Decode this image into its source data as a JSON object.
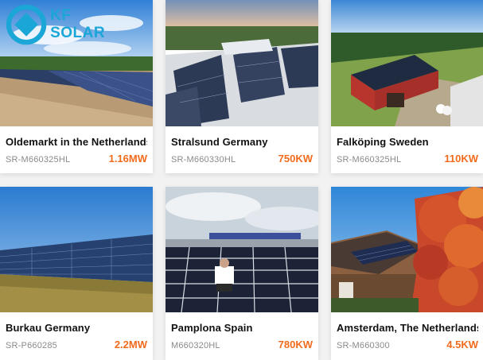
{
  "brand": {
    "logo_text": "KF SOLAR"
  },
  "colors": {
    "accent": "#f26b1d",
    "model_text": "#8a8a8a",
    "logo": "#1aa6d6"
  },
  "projects": [
    {
      "title": "Oldemarkt in the Netherlands",
      "model": "SR-M660325HL",
      "power": "1.16MW"
    },
    {
      "title": "Stralsund Germany",
      "model": "SR-M660330HL",
      "power": "750KW"
    },
    {
      "title": "Falköping Sweden",
      "model": "SR-M660325HL",
      "power": "110KW"
    },
    {
      "title": "Burkau Germany",
      "model": "SR-P660285",
      "power": "2.2MW"
    },
    {
      "title": "Pamplona Spain",
      "model": "M660320HL",
      "power": "780KW"
    },
    {
      "title": "Amsterdam, The Netherlands",
      "model": "SR-M660300",
      "power": "4.5KW"
    }
  ]
}
